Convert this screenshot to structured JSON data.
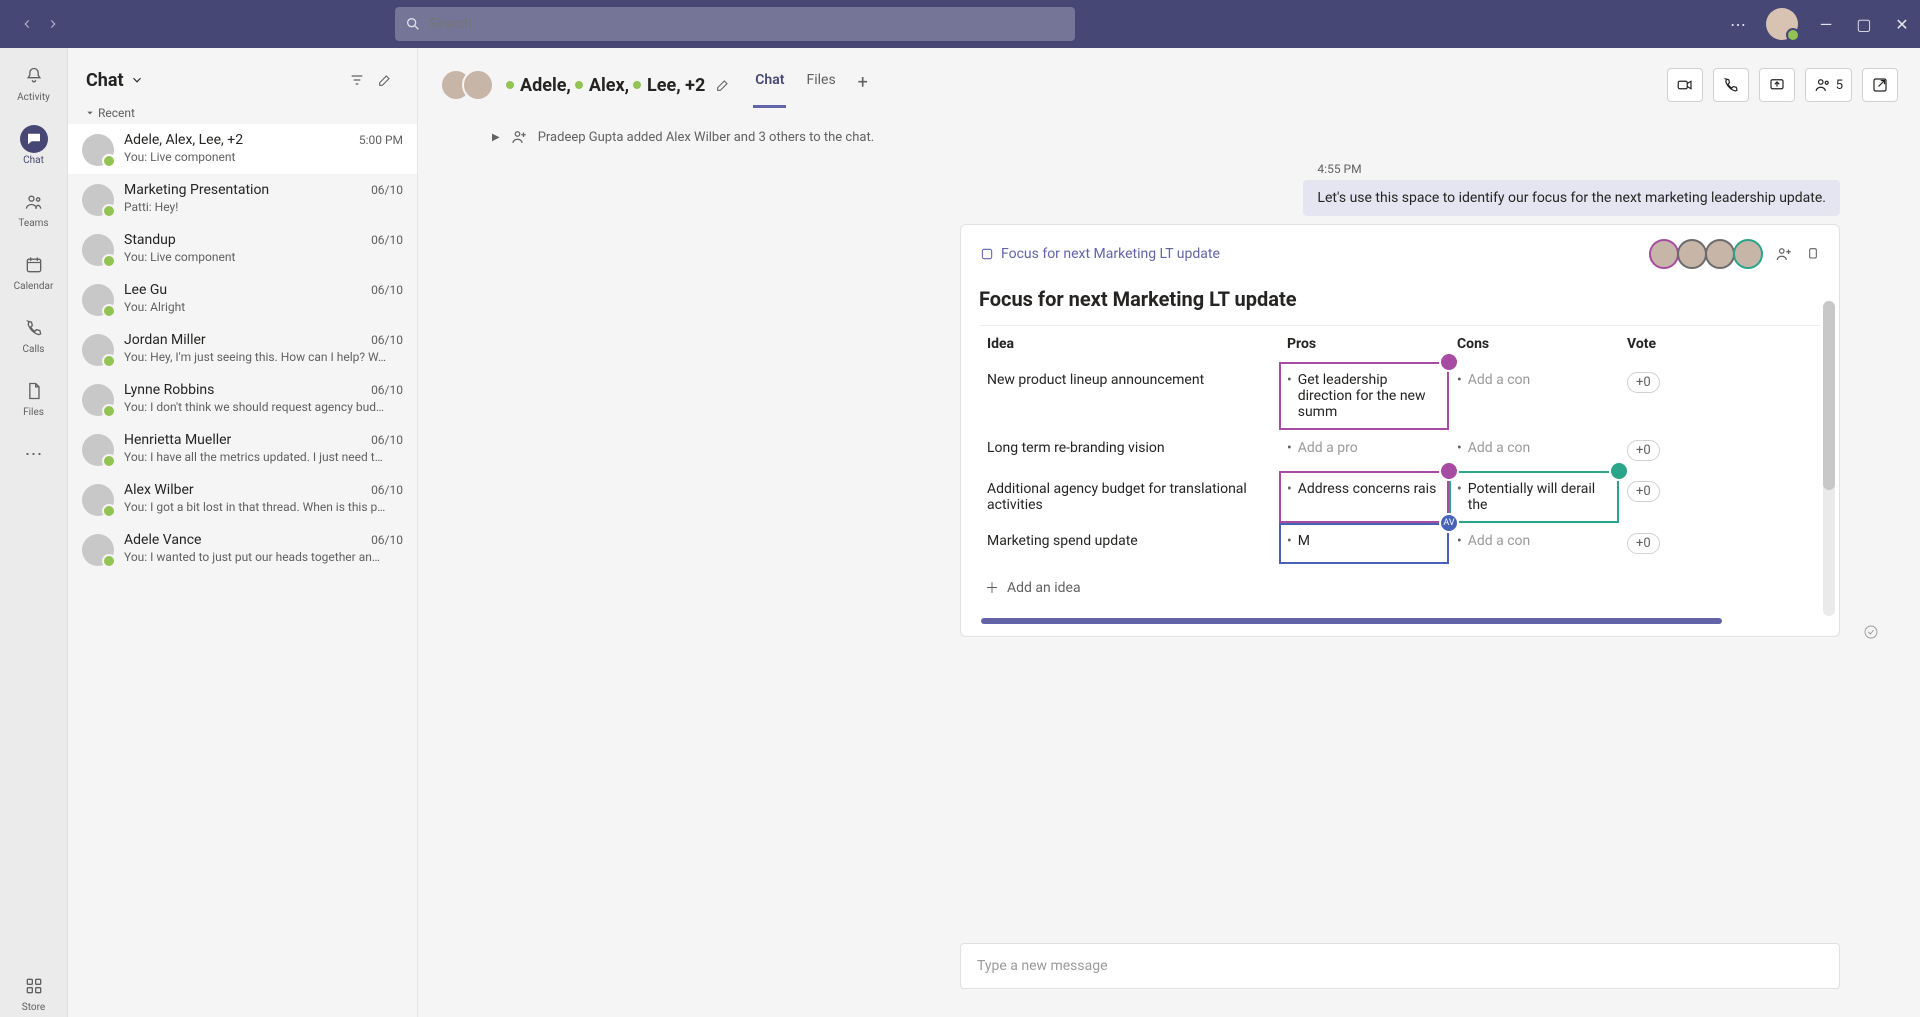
{
  "search": {
    "placeholder": "Search"
  },
  "rail": [
    {
      "id": "activity",
      "label": "Activity"
    },
    {
      "id": "chat",
      "label": "Chat"
    },
    {
      "id": "teams",
      "label": "Teams"
    },
    {
      "id": "calendar",
      "label": "Calendar"
    },
    {
      "id": "calls",
      "label": "Calls"
    },
    {
      "id": "files",
      "label": "Files"
    }
  ],
  "rail_store": {
    "label": "Store"
  },
  "chatlist": {
    "title": "Chat",
    "recent_label": "Recent",
    "items": [
      {
        "name": "Adele, Alex, Lee, +2",
        "time": "5:00 PM",
        "preview": "You: Live component"
      },
      {
        "name": "Marketing Presentation",
        "time": "06/10",
        "preview": "Patti: Hey!"
      },
      {
        "name": "Standup",
        "time": "06/10",
        "preview": "You: Live component"
      },
      {
        "name": "Lee Gu",
        "time": "06/10",
        "preview": "You: Alright"
      },
      {
        "name": "Jordan Miller",
        "time": "06/10",
        "preview": "You: Hey, I'm just seeing this. How can I help? W…"
      },
      {
        "name": "Lynne Robbins",
        "time": "06/10",
        "preview": "You: I don't think we should request agency bud…"
      },
      {
        "name": "Henrietta Mueller",
        "time": "06/10",
        "preview": "You: I have all the metrics updated. I just need t…"
      },
      {
        "name": "Alex Wilber",
        "time": "06/10",
        "preview": "You: I got a bit lost in that thread. When is this p…"
      },
      {
        "name": "Adele Vance",
        "time": "06/10",
        "preview": "You: I wanted to just put our heads together an…"
      }
    ]
  },
  "conv": {
    "participants": [
      "Adele,",
      "Alex,",
      "Lee, +2"
    ],
    "tabs": [
      {
        "label": "Chat"
      },
      {
        "label": "Files"
      }
    ],
    "participant_count": "5",
    "system_message": "Pradeep Gupta added Alex Wilber and 3 others to the chat.",
    "message": {
      "time": "4:55 PM",
      "text": "Let's use this space to identify our focus for the next marketing leadership update."
    }
  },
  "card": {
    "link_title": "Focus for next Marketing LT update",
    "heading": "Focus for next Marketing LT update",
    "columns": {
      "idea": "Idea",
      "pros": "Pros",
      "cons": "Cons",
      "vote": "Vote"
    },
    "add_pro": "Add a pro",
    "add_con": "Add a con",
    "vote_default": "+0",
    "rows": [
      {
        "idea": "New product lineup announcement",
        "pro": "Get leadership direction for the new summ",
        "con": "",
        "vote": "+0"
      },
      {
        "idea": "Long term re-branding vision",
        "pro": "",
        "con": "",
        "vote": "+0"
      },
      {
        "idea": "Additional agency budget for translational activities",
        "pro": "Address concerns rais",
        "con": "Potentially will derail the",
        "vote": "+0"
      },
      {
        "idea": "Marketing spend update",
        "pro": "M",
        "con": "",
        "vote": "+0"
      }
    ],
    "add_idea": "Add an idea"
  },
  "compose": {
    "placeholder": "Type a new message"
  }
}
